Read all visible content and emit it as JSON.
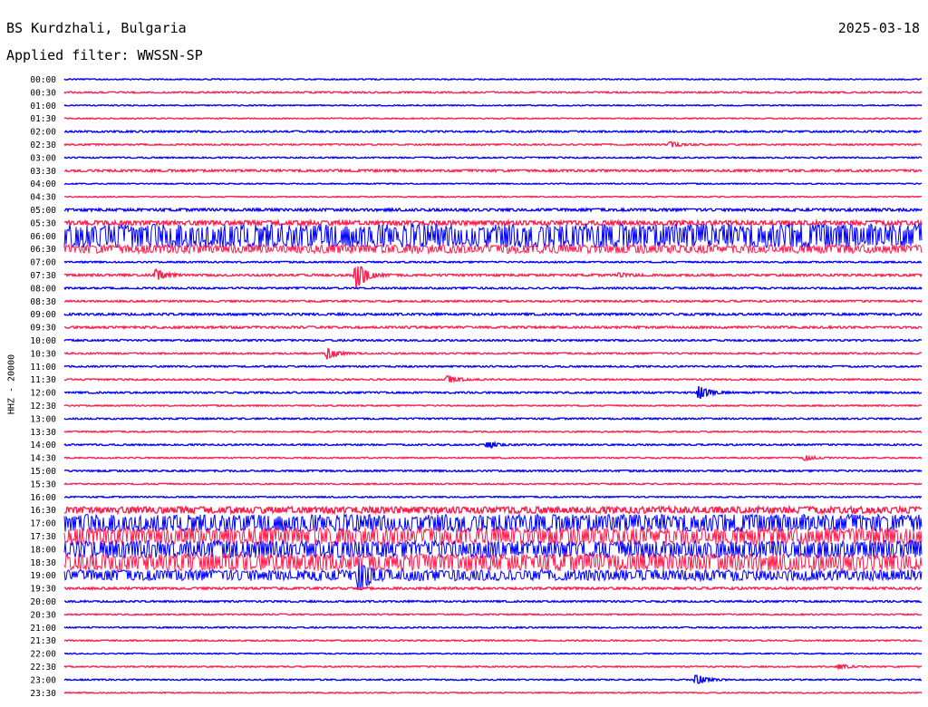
{
  "header": {
    "station": "BS Kurdzhali, Bulgaria",
    "date": "2025-03-18",
    "filter": "Applied filter: WWSSN-SP"
  },
  "chart_data": {
    "type": "line",
    "title": "BS Kurdzhali, Bulgaria",
    "date": "2025-03-18",
    "filter": "WWSSN-SP",
    "ylabel": "HHZ - 20000",
    "time_labels": [
      "00:00",
      "00:30",
      "01:00",
      "01:30",
      "02:00",
      "02:30",
      "03:00",
      "03:30",
      "04:00",
      "04:30",
      "05:00",
      "05:30",
      "06:00",
      "06:30",
      "07:00",
      "07:30",
      "08:00",
      "08:30",
      "09:00",
      "09:30",
      "10:00",
      "10:30",
      "11:00",
      "11:30",
      "12:00",
      "12:30",
      "13:00",
      "13:30",
      "14:00",
      "14:30",
      "15:00",
      "15:30",
      "16:00",
      "16:30",
      "17:00",
      "17:30",
      "18:00",
      "18:30",
      "19:00",
      "19:30",
      "20:00",
      "20:30",
      "21:00",
      "21:30",
      "22:00",
      "22:30",
      "23:00",
      "23:30"
    ],
    "x_minutes_range": [
      0,
      30
    ],
    "colors": {
      "even": "#0000ff",
      "odd": "#ff1f4e"
    },
    "noise_amplitude_per_trace": [
      0.5,
      0.7,
      0.5,
      0.5,
      0.8,
      0.7,
      0.6,
      1,
      0.5,
      0.5,
      1.2,
      2,
      11,
      4,
      0.7,
      1,
      0.8,
      0.8,
      1,
      1,
      0.8,
      0.7,
      0.7,
      0.7,
      0.8,
      0.6,
      0.7,
      0.6,
      0.7,
      0.6,
      0.8,
      0.6,
      0.6,
      3,
      8,
      8,
      8,
      8,
      5,
      1,
      0.8,
      0.6,
      0.6,
      0.6,
      0.5,
      0.6,
      0.6,
      0.5
    ],
    "events": [
      {
        "trace": "02:30",
        "minute": 21.2,
        "amplitude": 3
      },
      {
        "trace": "07:30",
        "minute": 3.2,
        "amplitude": 6
      },
      {
        "trace": "07:30",
        "minute": 10.2,
        "amplitude": 16
      },
      {
        "trace": "07:30",
        "minute": 19.4,
        "amplitude": 2
      },
      {
        "trace": "10:30",
        "minute": 9.2,
        "amplitude": 7
      },
      {
        "trace": "11:30",
        "minute": 13.4,
        "amplitude": 5
      },
      {
        "trace": "12:00",
        "minute": 22.2,
        "amplitude": 8
      },
      {
        "trace": "14:00",
        "minute": 14.8,
        "amplitude": 4
      },
      {
        "trace": "14:30",
        "minute": 25.9,
        "amplitude": 3
      },
      {
        "trace": "19:00",
        "minute": 10.3,
        "amplitude": 18
      },
      {
        "trace": "22:30",
        "minute": 27.1,
        "amplitude": 3
      },
      {
        "trace": "23:00",
        "minute": 22.1,
        "amplitude": 6
      }
    ]
  }
}
